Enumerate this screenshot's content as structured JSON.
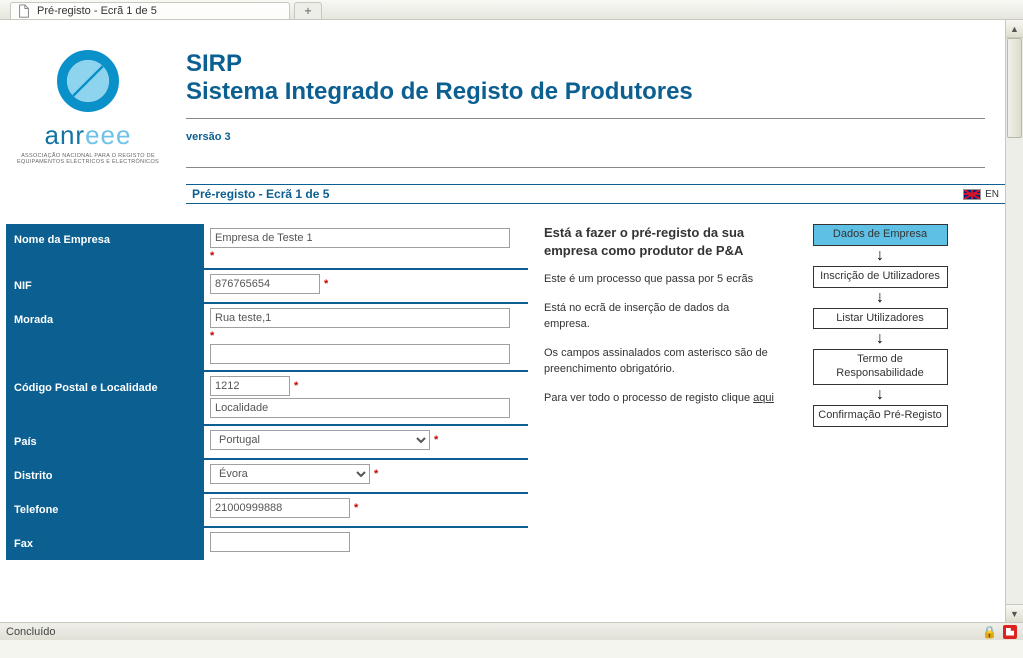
{
  "browser": {
    "tab_title": "Pré-registo - Ecrã 1 de 5",
    "status_text": "Concluído"
  },
  "header": {
    "logo_word_prefix": "anr",
    "logo_word_suffix": "eee",
    "logo_subtitle": "ASSOCIAÇÃO NACIONAL PARA O REGISTO DE EQUIPAMENTOS ELÉCTRICOS E ELECTRÓNICOS",
    "app_name": "SIRP",
    "app_title": "Sistema Integrado de Registo de Produtores",
    "version": "versão 3",
    "breadcrumb": "Pré-registo - Ecrã 1 de 5",
    "lang_code": "EN"
  },
  "form": {
    "fields": {
      "nome_empresa": {
        "label": "Nome da Empresa",
        "value": "Empresa de Teste 1"
      },
      "nif": {
        "label": "NIF",
        "value": "876765654"
      },
      "morada": {
        "label": "Morada",
        "value1": "Rua teste,1",
        "value2": ""
      },
      "cp_loc": {
        "label": "Código Postal e Localidade",
        "cp": "1212",
        "loc": "Localidade"
      },
      "pais": {
        "label": "País",
        "value": "Portugal"
      },
      "distrito": {
        "label": "Distrito",
        "value": "Évora"
      },
      "telefone": {
        "label": "Telefone",
        "value": "21000999888"
      },
      "fax": {
        "label": "Fax",
        "value": ""
      }
    },
    "required_mark": "*"
  },
  "description": {
    "heading": "Está a fazer o pré-registo da sua empresa como produtor de P&A",
    "p1": "Este é um processo que passa por 5 ecrãs",
    "p2": "Está no ecrã de inserção de dados da empresa.",
    "p3": "Os campos assinalados com asterisco são de preenchimento obrigatório.",
    "p4a": "Para ver todo o processo de registo clique ",
    "p4_link": "aqui"
  },
  "steps": {
    "s1": "Dados de Empresa",
    "s2": "Inscrição de Utilizadores",
    "s3": "Listar Utilizadores",
    "s4": "Termo de Responsabilidade",
    "s5": "Confirmação Pré-Registo"
  }
}
